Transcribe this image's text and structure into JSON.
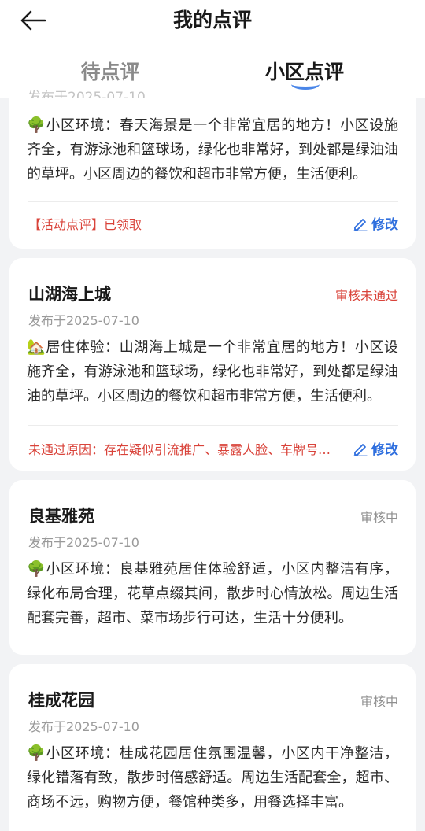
{
  "header": {
    "title": "我的点评",
    "back_icon": "arrow-left-icon"
  },
  "tabs": [
    {
      "label": "待点评",
      "active": false
    },
    {
      "label": "小区点评",
      "active": true
    }
  ],
  "accent_color": "#2f6fde",
  "reject_color": "#d9433a",
  "reviews": [
    {
      "name": "",
      "date": "发布于2025-07-10",
      "emoji": "🌳",
      "content": "小区环境：春天海景是一个非常宜居的地方！小区设施齐全，有游泳池和篮球场，绿化也非常好，到处都是绿油油的草坪。小区周边的餐饮和超市非常方便，生活便利。",
      "footer": "【活动点评】已领取",
      "edit_label": "修改"
    },
    {
      "name": "山湖海上城",
      "status": "审核未通过",
      "date": "发布于2025-07-10",
      "emoji": "🏡",
      "content": "居住体验：山湖海上城是一个非常宜居的地方！小区设施齐全，有游泳池和篮球场，绿化也非常好，到处都是绿油油的草坪。小区周边的餐饮和超市非常方便，生活便利。",
      "footer": "未通过原因：存在疑似引流推广、暴露人脸、车牌号等信息",
      "edit_label": "修改"
    },
    {
      "name": "良基雅苑",
      "status": "审核中",
      "date": "发布于2025-07-10",
      "emoji": "🌳",
      "content": "小区环境：良基雅苑居住体验舒适，小区内整洁有序，绿化布局合理，花草点缀其间，散步时心情放松。周边生活配套完善，超市、菜市场步行可达，生活十分便利。"
    },
    {
      "name": "桂成花园",
      "status": "审核中",
      "date": "发布于2025-07-10",
      "emoji": "🌳",
      "content": "小区环境：桂成花园居住氛围温馨，小区内干净整洁，绿化错落有致，散步时倍感舒适。周边生活配套全，超市、商场不远，购物方便，餐馆种类多，用餐选择丰富。"
    }
  ]
}
